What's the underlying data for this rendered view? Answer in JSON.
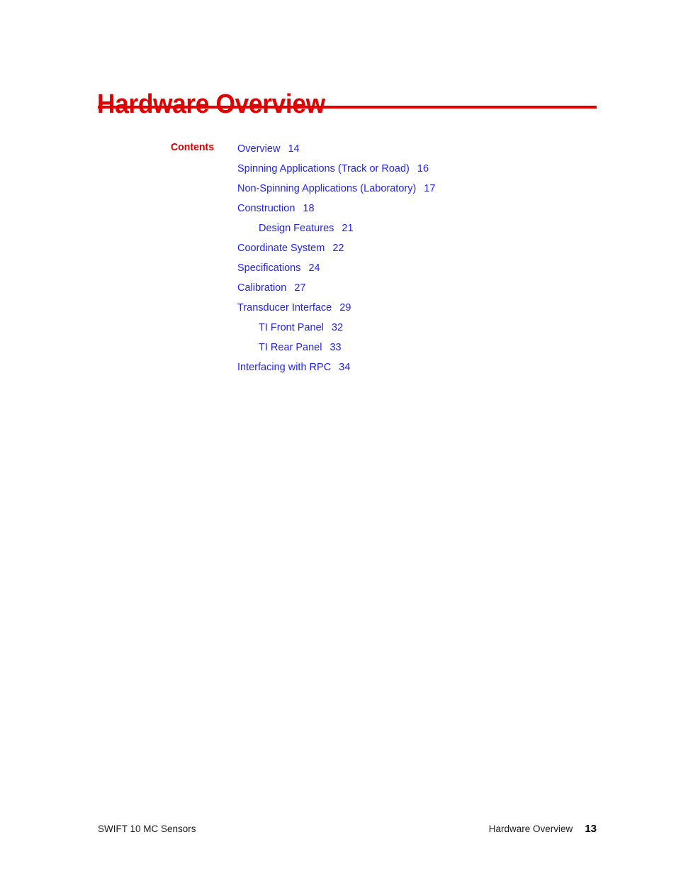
{
  "page": {
    "background_color": "#ffffff",
    "accent_color": "#e00000",
    "link_color": "#2222ee",
    "text_color": "#1a1a1a"
  },
  "chapter": {
    "title": "Hardware Overview"
  },
  "contents": {
    "label": "Contents",
    "entries": [
      {
        "title": "Overview",
        "page": "14",
        "level": 1
      },
      {
        "title": "Spinning Applications (Track or Road)",
        "page": "16",
        "level": 1
      },
      {
        "title": "Non-Spinning Applications (Laboratory)",
        "page": "17",
        "level": 1
      },
      {
        "title": "Construction",
        "page": "18",
        "level": 1
      },
      {
        "title": "Design Features",
        "page": "21",
        "level": 2
      },
      {
        "title": "Coordinate System",
        "page": "22",
        "level": 1
      },
      {
        "title": "Specifications",
        "page": "24",
        "level": 1
      },
      {
        "title": "Calibration",
        "page": "27",
        "level": 1
      },
      {
        "title": "Transducer Interface",
        "page": "29",
        "level": 1
      },
      {
        "title": "TI Front Panel",
        "page": "32",
        "level": 2
      },
      {
        "title": "TI Rear Panel",
        "page": "33",
        "level": 2
      },
      {
        "title": "Interfacing with RPC",
        "page": "34",
        "level": 1
      }
    ]
  },
  "footer": {
    "left": "SWIFT 10 MC Sensors",
    "chapter": "Hardware Overview",
    "page_number": "13"
  }
}
